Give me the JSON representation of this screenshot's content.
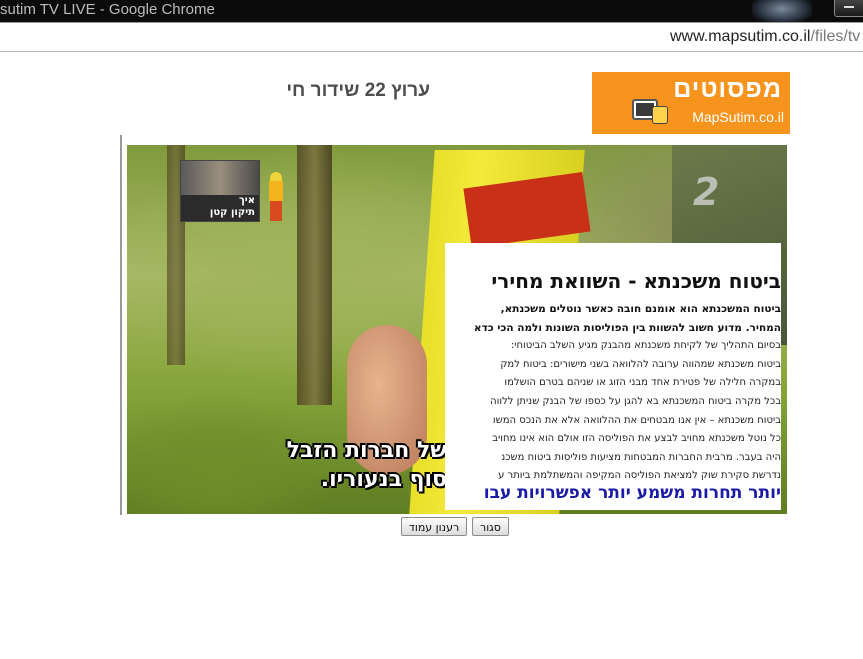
{
  "window": {
    "title": "sutim TV LIVE - Google Chrome"
  },
  "address_bar": {
    "domain": "www.mapsutim.co.il",
    "path": "/files/tv"
  },
  "page": {
    "title": "ערוץ 22 שידור חי",
    "logo": {
      "brand": "מפסוטים",
      "domain": "MapSutim.co.il"
    }
  },
  "player": {
    "channel_logo": "2",
    "thumbnail": {
      "line1": "איך",
      "line2": "תיקון קטן"
    },
    "subtitles": {
      "line1": "של חברות הזבל",
      "line2": "סוף בנעוריו."
    },
    "ad": {
      "title": "ביטוח משכנתא - השוואת מחירי",
      "lines": [
        {
          "text": "ביטוח המשכנתא הוא אומנם חובה כאשר נוטלים משכנתא,",
          "bold": true
        },
        {
          "text": "המחיר. מדוע חשוב להשוות בין הפוליסות השונות ולמה הכי כדא",
          "bold": true
        },
        {
          "text": "בסיום התהליך של לקיחת משכנתא מהבנק מגיע השלב הביטוחי:",
          "bold": false
        },
        {
          "text": "ביטוח משכנתא שמהווה ערובה להלוואה בשני מישורים: ביטוח למק",
          "bold": false
        },
        {
          "text": "במקרה חלילה של פטירת אחד מבני הזוג או שניהם בטרם הושלמו",
          "bold": false
        },
        {
          "text": "בכל מקרה ביטוח המשכנתא בא להגן על כספו של הבנק שניתן ללווה",
          "bold": false
        },
        {
          "text": "ביטוח משכנתא – אין אנו מבטחים את ההלוואה אלא את הנכס המשו",
          "bold": false
        },
        {
          "text": "כל נוטל משכנתא מחויב לבצע את הפוליסה הזו אולם הוא אינו מחויב",
          "bold": false
        },
        {
          "text": "היה בעבר. מרבית החברות המבטחות מציעות פוליסות ביטוח משכנ",
          "bold": false
        },
        {
          "text": "נדרשת סקירת שוק למציאת הפוליסה המקיפה והמשתלמת ביותר ע",
          "bold": false
        }
      ],
      "cta": "יותר תחרות משמע יותר אפשרויות עבו"
    }
  },
  "buttons": {
    "refresh": "רענון עמוד",
    "close": "סגור"
  },
  "colors": {
    "logo_bg": "#f7941d",
    "ad_cta": "#1a1aa6",
    "title_text": "#4d4d4d"
  }
}
